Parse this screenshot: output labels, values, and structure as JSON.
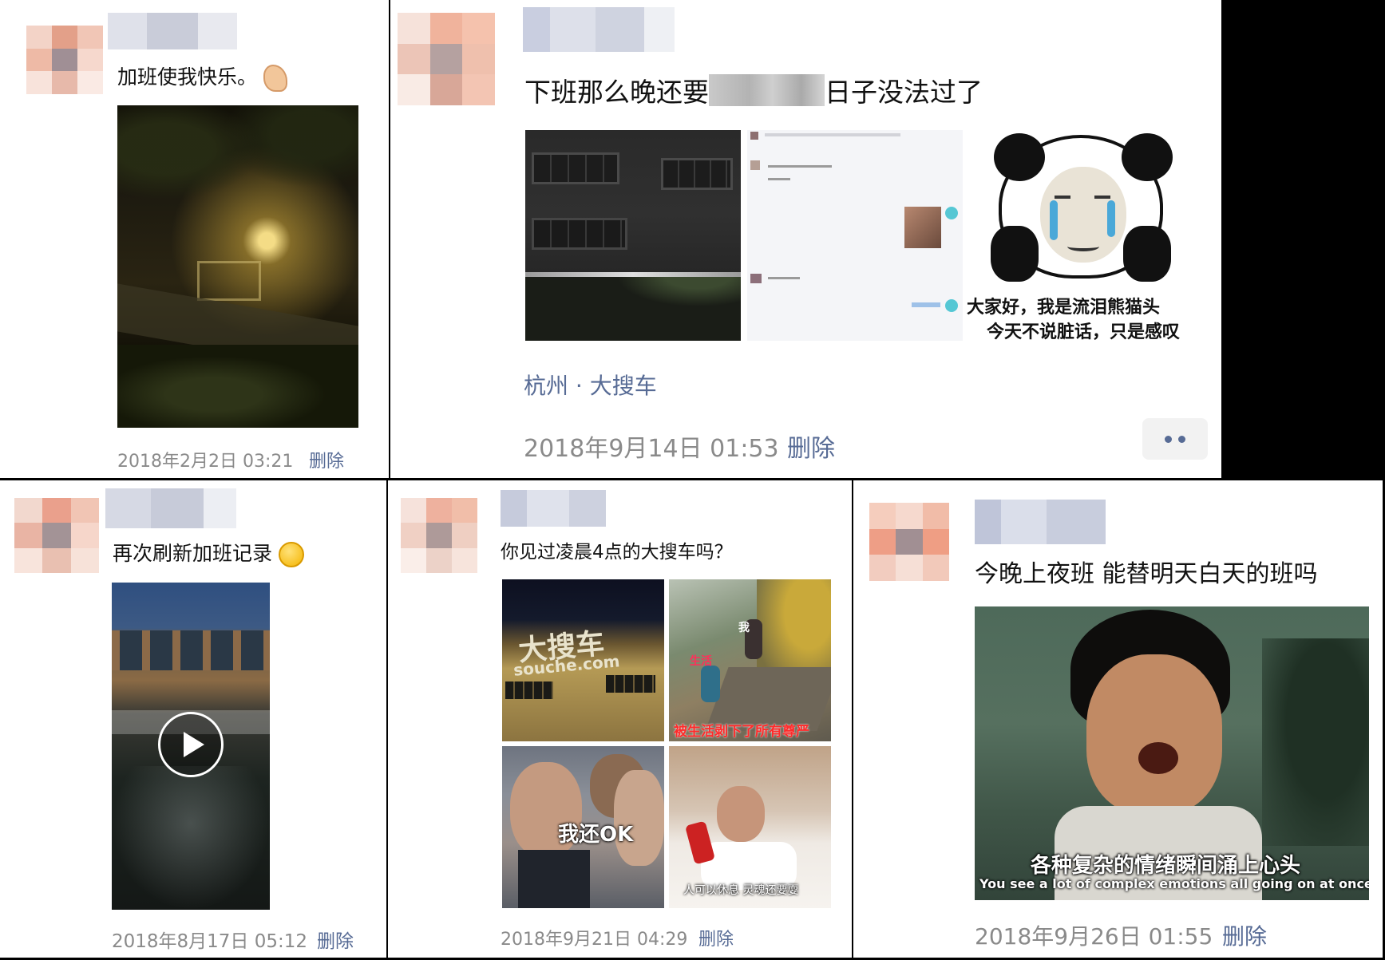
{
  "colors": {
    "link": "#576b95",
    "timestamp": "#8a8a8a",
    "divider": "#000000"
  },
  "posts": [
    {
      "text": "加班使我快乐。",
      "emoji": "flexed-biceps-emoji",
      "images": [
        {
          "desc": "night-street-photo"
        }
      ],
      "time": "2018年2月2日 03:21",
      "delete_label": "删除"
    },
    {
      "text_before": "下班那么晚还要",
      "text_after": "日子没法过了",
      "images": [
        {
          "desc": "office-building-night-photo"
        },
        {
          "desc": "chat-screenshot"
        },
        {
          "desc": "crying-panda-meme",
          "caption_line1": "大家好，我是流泪熊猫头",
          "caption_line2": "今天不说脏话，只是感叹"
        }
      ],
      "location": "杭州 · 大搜车",
      "time": "2018年9月14日 01:53",
      "delete_label": "删除"
    },
    {
      "text": "再次刷新加班记录",
      "emoji": "thinking-face-emoji",
      "images": [
        {
          "desc": "rainy-night-video"
        }
      ],
      "time": "2018年8月17日 05:12",
      "delete_label": "删除"
    },
    {
      "text": "你见过凌晨4点的大搜车吗？",
      "images": [
        {
          "desc": "souche-building-sign",
          "label": "大搜车",
          "sublabel": "souche.com"
        },
        {
          "desc": "climbing-meme",
          "label_top": "我",
          "label_mid": "生活",
          "caption": "被生活剥下了所有尊严"
        },
        {
          "desc": "crowded-subway-meme",
          "caption": "我还OK"
        },
        {
          "desc": "tired-in-bed-meme",
          "caption": "人可以休息 灵魂还要耍"
        }
      ],
      "time": "2018年9月21日 04:29",
      "delete_label": "删除"
    },
    {
      "text": "今晚上夜班 能替明天白天的班吗",
      "images": [
        {
          "desc": "bruce-lee-meme",
          "caption_cn": "各种复杂的情绪瞬间涌上心头",
          "caption_en": "You see a lot of complex emotions all going on at once."
        }
      ],
      "time": "2018年9月26日 01:55",
      "delete_label": "删除"
    }
  ]
}
